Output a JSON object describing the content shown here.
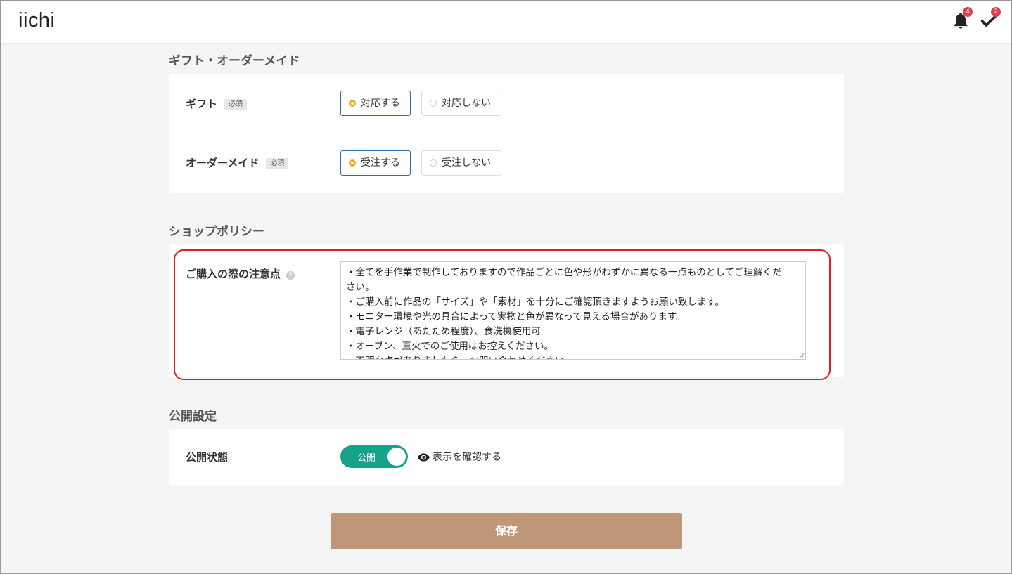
{
  "header": {
    "logo": "iichi",
    "notifications_badge": "4",
    "tasks_badge": "2"
  },
  "gift_section": {
    "title": "ギフト・オーダーメイド",
    "gift": {
      "label": "ギフト",
      "required": "必須",
      "options": [
        "対応する",
        "対応しない"
      ],
      "selected": "対応する"
    },
    "order": {
      "label": "オーダーメイド",
      "required": "必須",
      "options": [
        "受注する",
        "受注しない"
      ],
      "selected": "受注する"
    }
  },
  "policy_section": {
    "title": "ショップポリシー",
    "label": "ご購入の際の注意点",
    "help_icon": "?",
    "lines": [
      "・全てを手作業で制作しておりますので作品ごとに色や形がわずかに異なる一点ものとしてご理解くだ",
      "さい。",
      "・ご購入前に作品の「サイズ」や「素材」を十分にご確認頂きますようお願い致します。",
      "・モニター環境や光の具合によって実物と色が異なって見える場合があります。",
      "・電子レンジ（あたため程度）、食洗機使用可",
      "・オーブン、直火でのご使用はお控えください。",
      "・不明な点がありましたら、お問い合わせください。"
    ]
  },
  "publish_section": {
    "title": "公開設定",
    "label": "公開状態",
    "toggle_label": "公開",
    "toggle_on": true,
    "preview_link": "表示を確認する"
  },
  "save_label": "保存",
  "colors": {
    "accent_selected_border": "#2f6fa8",
    "radio_selected": "#f0a81e",
    "toggle_on": "#14a389",
    "save_button": "#c09679",
    "highlight": "#e01e1e",
    "badge": "#e0404a"
  }
}
